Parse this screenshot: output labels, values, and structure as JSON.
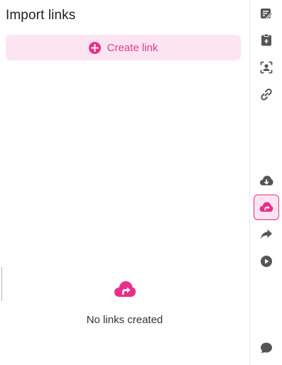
{
  "panel": {
    "title": "Import links",
    "create_button_label": "Create link",
    "empty_message": "No links created"
  },
  "rail": {
    "items": [
      {
        "name": "edit-note",
        "active": false
      },
      {
        "name": "clipboard",
        "active": false
      },
      {
        "name": "face-scan",
        "active": false
      },
      {
        "name": "link",
        "active": false
      },
      {
        "name": "cloud-download",
        "active": false
      },
      {
        "name": "cloud-import-link",
        "active": true
      },
      {
        "name": "share-forward",
        "active": false
      },
      {
        "name": "play-circle",
        "active": false
      },
      {
        "name": "chat",
        "active": false
      }
    ]
  },
  "colors": {
    "accent": "#e8308a",
    "accent_light": "#fde4f1",
    "icon_gray": "#555555"
  }
}
